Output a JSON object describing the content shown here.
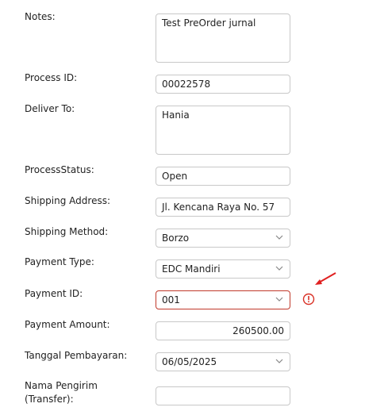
{
  "form": {
    "notes": {
      "label": "Notes:",
      "value": "Test PreOrder jurnal"
    },
    "process_id": {
      "label": "Process ID:",
      "value": "00022578"
    },
    "deliver_to": {
      "label": "Deliver To:",
      "value": "Hania"
    },
    "process_status": {
      "label": "ProcessStatus:",
      "value": "Open"
    },
    "shipping_address": {
      "label": "Shipping Address:",
      "value": "Jl. Kencana Raya No. 57"
    },
    "shipping_method": {
      "label": "Shipping Method:",
      "value": "Borzo"
    },
    "payment_type": {
      "label": "Payment Type:",
      "value": "EDC Mandiri"
    },
    "payment_id": {
      "label": "Payment ID:",
      "value": "001"
    },
    "payment_amount": {
      "label": "Payment Amount:",
      "value": "260500.00"
    },
    "payment_date": {
      "label": "Tanggal Pembayaran:",
      "value": "06/05/2025"
    },
    "sender_name": {
      "label": "Nama Pengirim (Transfer):",
      "value": ""
    }
  },
  "icons": {
    "chevron": "chevron-down-icon",
    "error": "error-icon",
    "annotation": "red-arrow-icon"
  },
  "colors": {
    "error": "#d93025",
    "border": "#c8c8c8",
    "text": "#222222"
  }
}
